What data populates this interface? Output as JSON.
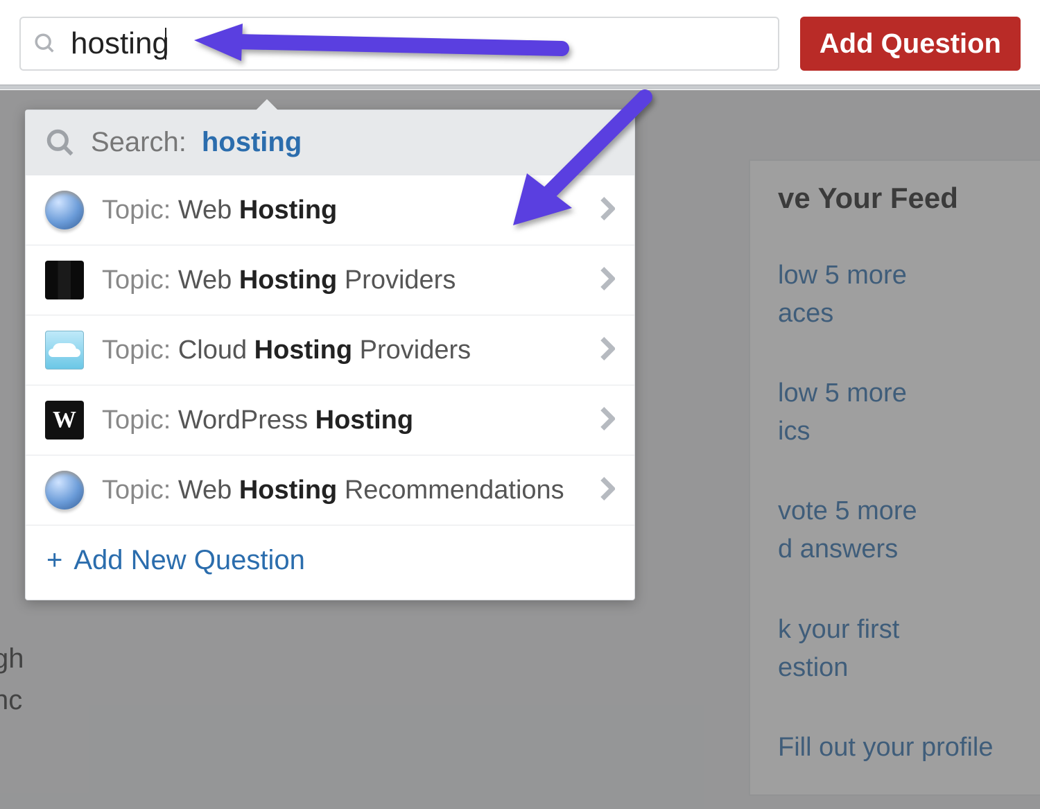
{
  "search": {
    "value": "hosting",
    "placeholder": ""
  },
  "header": {
    "add_question_label": "Add Question"
  },
  "dropdown": {
    "search_label": "Search:",
    "search_term": "hosting",
    "items": [
      {
        "prefix": "Topic: ",
        "lead": "Web ",
        "bold": "Hosting",
        "tail": ""
      },
      {
        "prefix": "Topic: ",
        "lead": "Web ",
        "bold": "Hosting",
        "tail": " Providers"
      },
      {
        "prefix": "Topic: ",
        "lead": "Cloud ",
        "bold": "Hosting",
        "tail": " Providers"
      },
      {
        "prefix": "Topic: ",
        "lead": "WordPress ",
        "bold": "Hosting",
        "tail": ""
      },
      {
        "prefix": "Topic: ",
        "lead": "Web ",
        "bold": "Hosting",
        "tail": " Recommendations"
      }
    ],
    "add_new_question_label": "Add New Question"
  },
  "feed": {
    "title_fragment": "ve Your Feed",
    "items": [
      {
        "link_fragment": "low 5 more",
        "muted_fragment": "aces"
      },
      {
        "link_fragment": "low 5 more",
        "muted_fragment": "ics"
      },
      {
        "link_fragment": "vote 5 more",
        "muted_fragment": "d answers"
      },
      {
        "link_fragment": "k your first",
        "muted_fragment": "estion"
      }
    ],
    "bottom_link_fragment": "Fill out your profile"
  },
  "left_fragments": {
    "line1": "gh",
    "line2": "nc"
  }
}
